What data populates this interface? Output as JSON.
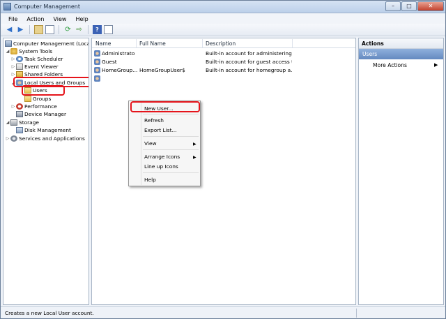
{
  "window": {
    "title": "Computer Management",
    "min": "–",
    "max": "□",
    "close": "✕"
  },
  "menu": [
    "File",
    "Action",
    "View",
    "Help"
  ],
  "toolbar": {
    "back": "◀",
    "forward": "▶",
    "refresh": "⟳",
    "export": "⇨",
    "help": "?"
  },
  "tree": {
    "root": "Computer Management (Local",
    "system_tools": "System Tools",
    "task_scheduler": "Task Scheduler",
    "event_viewer": "Event Viewer",
    "shared_folders": "Shared Folders",
    "local_users_groups": "Local Users and Groups",
    "users": "Users",
    "groups": "Groups",
    "performance": "Performance",
    "device_manager": "Device Manager",
    "storage": "Storage",
    "disk_management": "Disk Management",
    "services_apps": "Services and Applications"
  },
  "list": {
    "columns": [
      "Name",
      "Full Name",
      "Description"
    ],
    "rows": [
      {
        "name": "Administrator",
        "full_name": "",
        "description": "Built-in account for administering..."
      },
      {
        "name": "Guest",
        "full_name": "",
        "description": "Built-in account for guest access t..."
      },
      {
        "name": "HomeGroup...",
        "full_name": "HomeGroupUser$",
        "description": "Built-in account for homegroup a..."
      }
    ]
  },
  "actions": {
    "header": "Actions",
    "section": "Users",
    "more": "More Actions",
    "more_arrow": "▶"
  },
  "context_menu": {
    "new_user": "New User...",
    "refresh": "Refresh",
    "export_list": "Export List...",
    "view": "View",
    "arrange_icons": "Arrange Icons",
    "line_up_icons": "Line up Icons",
    "help": "Help",
    "submenu_arrow": "▶"
  },
  "status": {
    "text": "Creates a new Local User account."
  },
  "colors": {
    "highlight": "#e5141b",
    "actions_section": "#6489c0"
  }
}
